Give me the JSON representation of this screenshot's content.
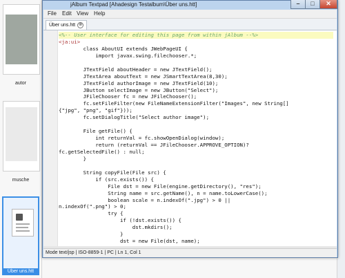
{
  "window": {
    "title": "jAlbum Textpad [Ahadesign Testalbum\\Über uns.htt]",
    "menu": [
      "File",
      "Edit",
      "View",
      "Help"
    ],
    "tab": {
      "label": "Über uns.htt",
      "close_glyph": "⊗"
    },
    "controls": {
      "minimize": "–",
      "maximize": "□",
      "close": "✕"
    }
  },
  "status": "Mode text/jsp | ISO-8859-1 | PC | Ln 1, Col 1",
  "explorer": {
    "thumb_labels": [
      "autor",
      "musche",
      "Über uns.htt"
    ]
  },
  "code_lines": [
    "<%-- User interface for editing this page from within jAlbum --%>",
    "<ja:ui>",
    "        class AboutUI extends JWebPageUI {",
    "            import javax.swing.filechooser.*;",
    "",
    "        JTextField aboutHeader = new JTextField();",
    "        JTextArea aboutText = new JSmartTextArea(8,30);",
    "        JTextField authorImage = new JTextField(10);",
    "        JButton selectImage = new JButton(\"Select\");",
    "        JFileChooser fc = new JFileChooser();",
    "        fc.setFileFilter(new FileNameExtensionFilter(\"Images\", new String[]",
    "{\"jpg\", \"png\", \"gif\"}));",
    "        fc.setDialogTitle(\"Select author image\");",
    "",
    "        File getFile() {",
    "            int returnVal = fc.showOpenDialog(window);",
    "            return (returnVal == JFileChooser.APPROVE_OPTION)?",
    "fc.getSelectedFile() : null;",
    "        }",
    "",
    "        String copyFile(File src) {",
    "            if (src.exists()) {",
    "                File dst = new File(engine.getDirectory(), \"res\");",
    "                String name = src.getName(), n = name.toLowerCase();",
    "                boolean scale = n.indexOf(\".jpg\") > 0 ||",
    "n.indexOf(\".png\") > 0;",
    "                try {",
    "                    if (!dst.exists()) {",
    "                        dst.mkdirs();",
    "                    }",
    "                    dst = new File(dst, name);"
  ],
  "colors": {
    "comment": "#6aa86a",
    "tag": "#aa3333",
    "highlight": "#fbfbbf",
    "selection": "#3a8ee6"
  }
}
